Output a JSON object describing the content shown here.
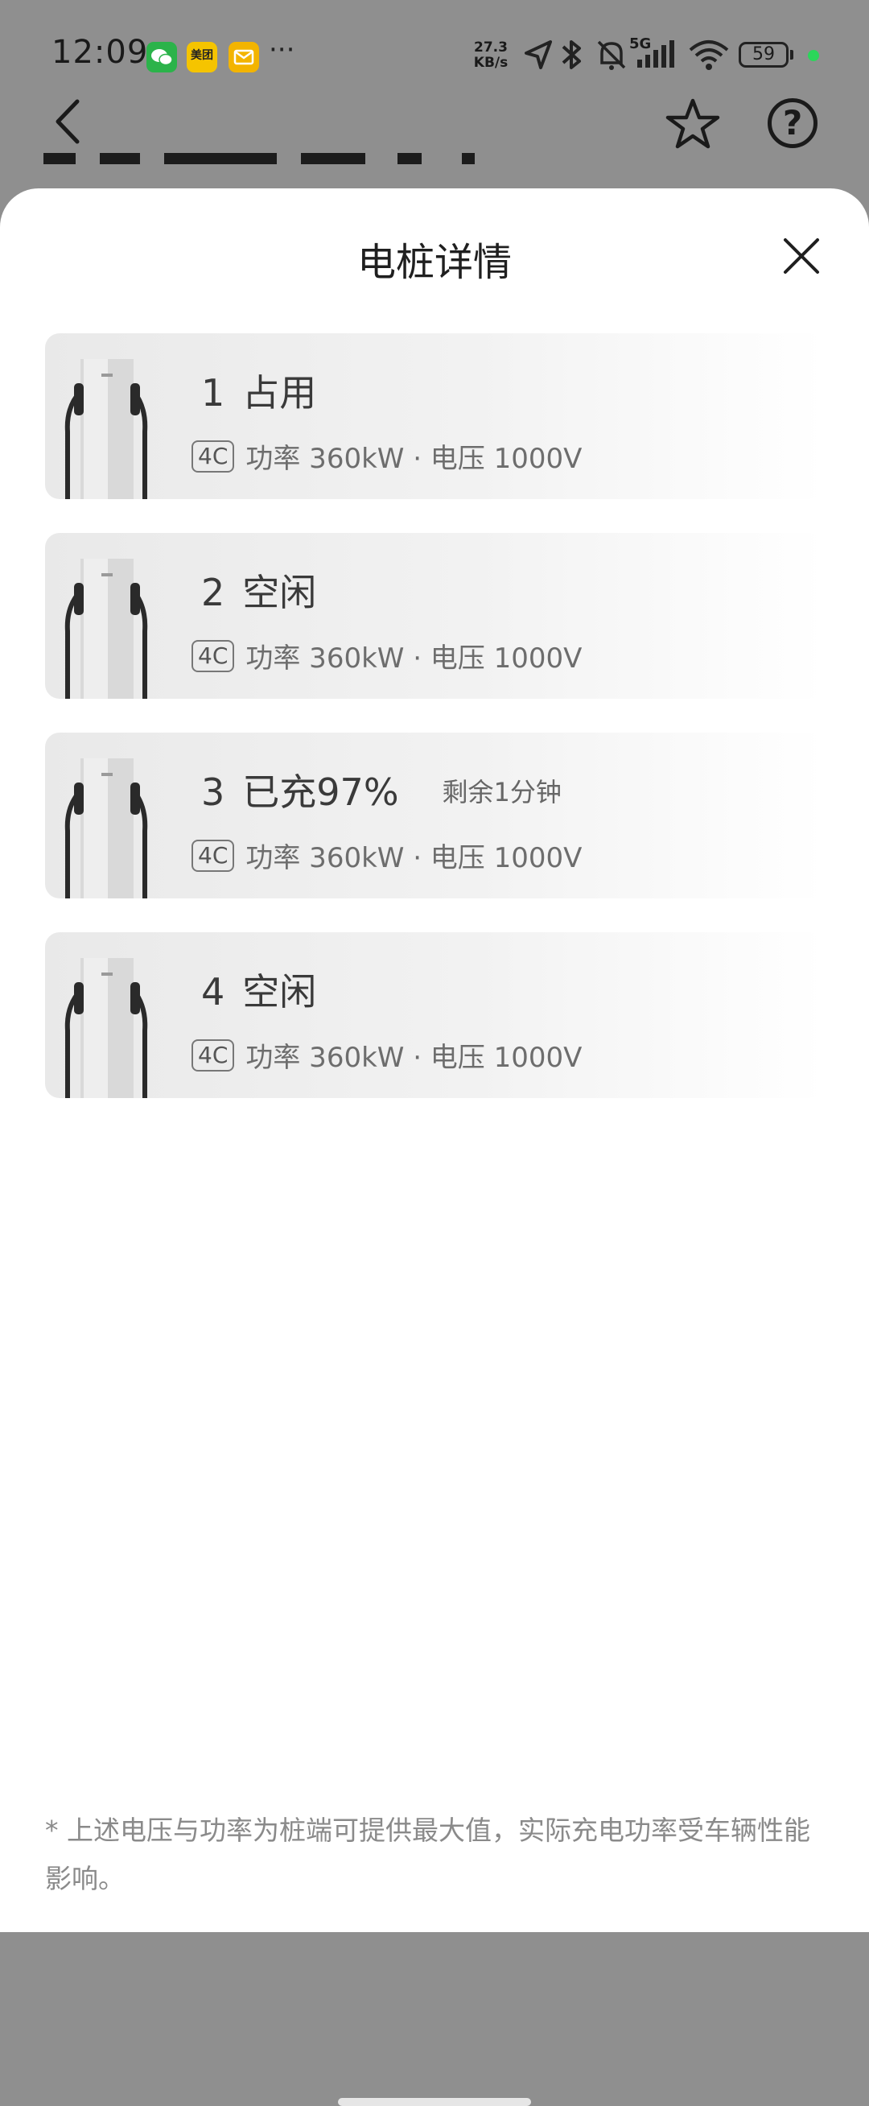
{
  "status_bar": {
    "time": "12:09",
    "net_speed_value": "27.3",
    "net_speed_unit": "KB/s",
    "network_type": "5G",
    "battery": "59",
    "icons": [
      "wechat-icon",
      "meituan-icon",
      "mail-icon",
      "more-icon",
      "location-icon",
      "bluetooth-icon",
      "mute-icon",
      "signal-icon",
      "wifi-icon",
      "battery-icon"
    ],
    "meituan_label": "美团"
  },
  "header": {
    "back_icon": "chevron-left-icon",
    "favorite_icon": "star-icon",
    "help_label": "?"
  },
  "sheet": {
    "title": "电桩详情",
    "close_icon": "close-icon",
    "piles": [
      {
        "number": "1",
        "status": "占用",
        "remaining": "",
        "tag": "4C",
        "specs": "功率 360kW · 电压 1000V"
      },
      {
        "number": "2",
        "status": "空闲",
        "remaining": "",
        "tag": "4C",
        "specs": "功率 360kW · 电压 1000V"
      },
      {
        "number": "3",
        "status": "已充97%",
        "remaining": "剩余1分钟",
        "tag": "4C",
        "specs": "功率 360kW · 电压 1000V"
      },
      {
        "number": "4",
        "status": "空闲",
        "remaining": "",
        "tag": "4C",
        "specs": "功率 360kW · 电压 1000V"
      }
    ],
    "footnote": "* 上述电压与功率为桩端可提供最大值，实际充电功率受车辆性能影响。"
  },
  "colors": {
    "accent_green": "#2bd65a",
    "sheet_bg": "#ffffff",
    "overlay": "#8f8f8f"
  }
}
